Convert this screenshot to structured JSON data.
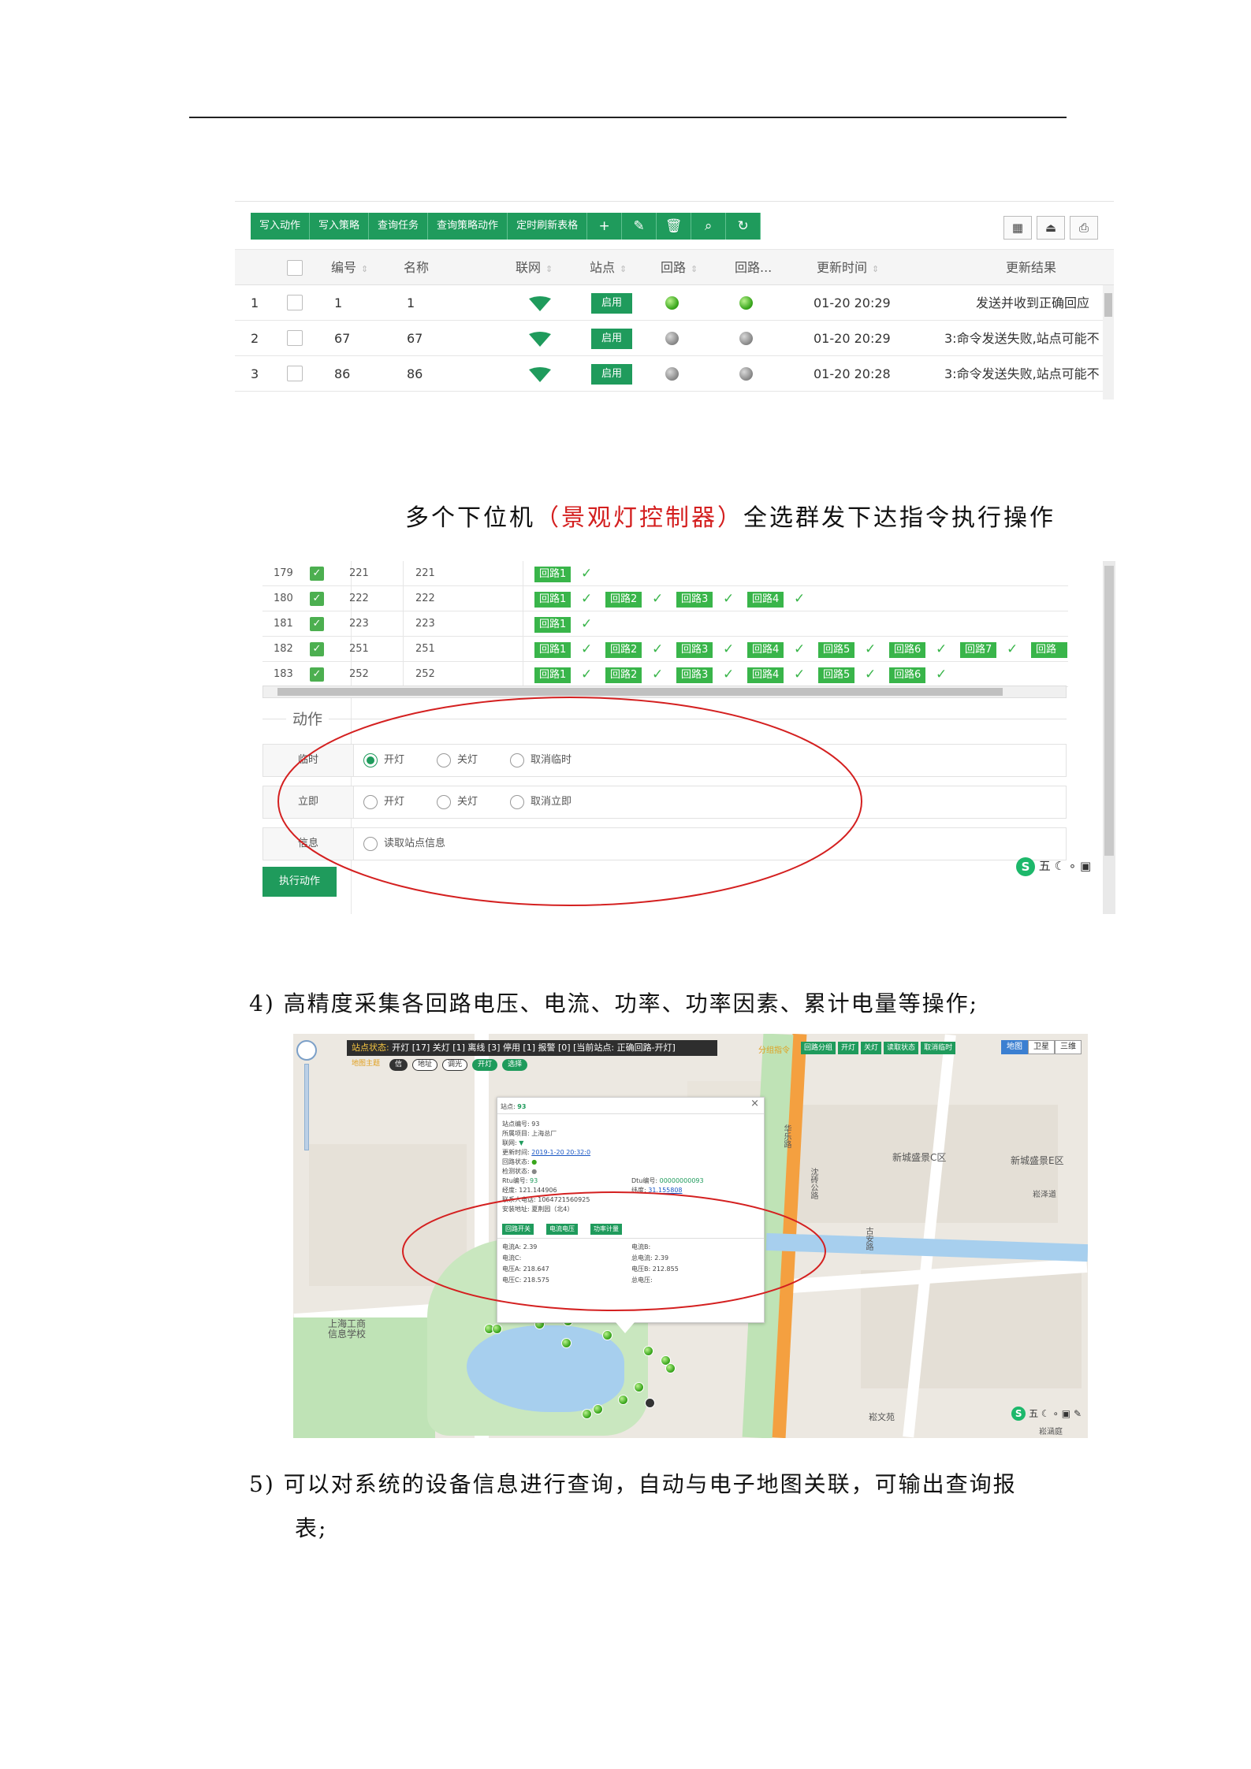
{
  "section_title": {
    "prefix": "多个下位机",
    "highlight": "（景观灯控制器）",
    "suffix": "全选群发下达指令执行操作"
  },
  "grid1": {
    "toolbar": [
      "写入动作",
      "写入策略",
      "查询任务",
      "查询策略动作",
      "定时刷新表格"
    ],
    "toolbar_icons": [
      "plus-icon",
      "pencil-icon",
      "trash-icon",
      "search-icon",
      "refresh-icon"
    ],
    "toolbar_icon_glyphs": [
      "+",
      "✎",
      "🗑",
      "⌕",
      "↻"
    ],
    "right_tools": [
      "▦",
      "⏏",
      "⎙"
    ],
    "headers": {
      "code": "编号",
      "name": "名称",
      "net": "联网",
      "station": "站点",
      "loop": "回路",
      "loop2": "回路...",
      "time": "更新时间",
      "result": "更新结果"
    },
    "rows": [
      {
        "idx": "1",
        "code": "1",
        "name": "1",
        "btn": "启用",
        "loop": "green",
        "loop2": "green",
        "time": "01-20 20:29",
        "result": "发送并收到正确回应"
      },
      {
        "idx": "2",
        "code": "67",
        "name": "67",
        "btn": "启用",
        "loop": "gray",
        "loop2": "gray",
        "time": "01-20 20:29",
        "result": "3:命令发送失败,站点可能不"
      },
      {
        "idx": "3",
        "code": "86",
        "name": "86",
        "btn": "启用",
        "loop": "gray",
        "loop2": "gray",
        "time": "01-20 20:28",
        "result": "3:命令发送失败,站点可能不"
      }
    ]
  },
  "grid2": {
    "rows": [
      {
        "idx": "179",
        "code": "221",
        "name": "221",
        "loops": [
          "回路1"
        ]
      },
      {
        "idx": "180",
        "code": "222",
        "name": "222",
        "loops": [
          "回路1",
          "回路2",
          "回路3",
          "回路4"
        ]
      },
      {
        "idx": "181",
        "code": "223",
        "name": "223",
        "loops": [
          "回路1"
        ]
      },
      {
        "idx": "182",
        "code": "251",
        "name": "251",
        "loops": [
          "回路1",
          "回路2",
          "回路3",
          "回路4",
          "回路5",
          "回路6",
          "回路7",
          "回路"
        ]
      },
      {
        "idx": "183",
        "code": "252",
        "name": "252",
        "loops": [
          "回路1",
          "回路2",
          "回路3",
          "回路4",
          "回路5",
          "回路6"
        ]
      }
    ],
    "section_label": "动作",
    "actions": [
      {
        "label": "临时",
        "options": [
          "开灯",
          "关灯",
          "取消临时"
        ],
        "selected": 0
      },
      {
        "label": "立即",
        "options": [
          "开灯",
          "关灯",
          "取消立即"
        ],
        "selected": -1
      },
      {
        "label": "信息",
        "options": [
          "读取站点信息"
        ],
        "selected": -1
      }
    ],
    "exec_button": "执行动作",
    "ime_text": "五"
  },
  "para4": "4) 高精度采集各回路电压、电流、功率、功率因素、累计电量等操作;",
  "map": {
    "status_label": "站点状态:",
    "status_items": "开灯 [17]  关灯 [1]  离线 [3]  停用 [1]  报警 [0]  [当前站点: 正确回路-开灯]",
    "pills": [
      "地图主题",
      "信",
      "地址",
      "调光",
      "开灯",
      "选择"
    ],
    "group_label": "分组指令",
    "buttons": [
      "回路分组",
      "开灯",
      "关灯",
      "读取状态",
      "取消临时"
    ],
    "map_types": [
      "地图",
      "卫星",
      "三维"
    ],
    "popup": {
      "title_label": "站点:",
      "title_value": "93",
      "lines": [
        {
          "k": "站点编号:",
          "v": "93"
        },
        {
          "k": "所属项目:",
          "v": "上海总厂"
        },
        {
          "k": "联网:",
          "v": ""
        },
        {
          "k": "更新时间:",
          "v": "2019-1-20 20:32:0"
        },
        {
          "k": "回路状态:",
          "v": ""
        },
        {
          "k": "检测状态:",
          "v": ""
        },
        {
          "k": "Rtu编号:",
          "v": "93"
        },
        {
          "k": "经度:",
          "v": "121.144906"
        },
        {
          "k": "联系人电话:",
          "v": "1064721560925"
        },
        {
          "k": "安装地址:",
          "v": "夏荆园（北4）"
        }
      ],
      "dtu_label": "Dtu编号:",
      "dtu_value": "00000000093",
      "lat_label": "纬度:",
      "lat_value": "31.155808",
      "btns": [
        "回路开关",
        "电流电压",
        "功率计量"
      ],
      "elec": [
        {
          "k": "电流A:",
          "v": "2.39"
        },
        {
          "k": "电流B:",
          "v": ""
        },
        {
          "k": "电流C:",
          "v": ""
        },
        {
          "k": "总电流:",
          "v": "2.39"
        },
        {
          "k": "电压A:",
          "v": "218.647"
        },
        {
          "k": "电压B:",
          "v": "212.855"
        },
        {
          "k": "电压C:",
          "v": "218.575"
        },
        {
          "k": "总电压:",
          "v": ""
        }
      ]
    },
    "labels": [
      "新城盛景C区",
      "新城盛景E区",
      "上海工商\n信息学校",
      "华乐路",
      "沈砖公路",
      "古安路",
      "崧文苑",
      "崧涵庭",
      "崧泽道"
    ]
  },
  "para5_line1": "5) 可以对系统的设备信息进行查询，自动与电子地图关联，可输出查询报",
  "para5_line2": "表;",
  "colors": {
    "brand_green": "#1f9b5c",
    "annot_red": "#d42020"
  }
}
